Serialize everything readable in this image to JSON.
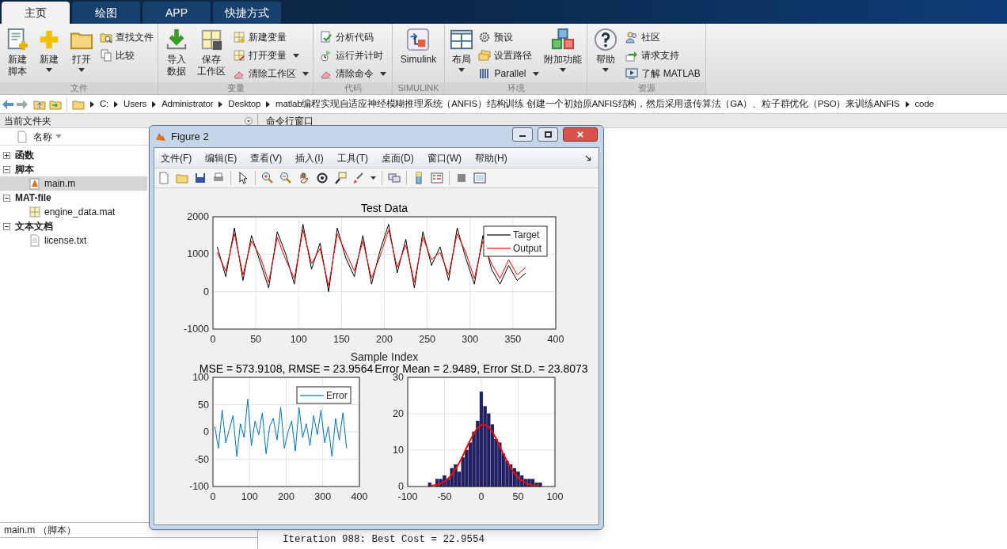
{
  "tabs": [
    {
      "label": "主页",
      "selected": true
    },
    {
      "label": "绘图",
      "selected": false
    },
    {
      "label": "APP",
      "selected": false
    },
    {
      "label": "快捷方式",
      "selected": false
    }
  ],
  "toolstrip": {
    "sections": [
      {
        "label": "文件",
        "groups": [
          {
            "kind": "large",
            "lines": [
              "新建",
              "脚本"
            ],
            "dropdown": false
          },
          {
            "kind": "large",
            "lines": [
              "新建"
            ],
            "dropdown": true
          },
          {
            "kind": "large",
            "lines": [
              "打开"
            ],
            "dropdown": true
          },
          {
            "kind": "column",
            "items": [
              {
                "label": "查找文件",
                "dropdown": false
              },
              {
                "label": "比较",
                "dropdown": false
              }
            ]
          }
        ]
      },
      {
        "label": "变量",
        "groups": [
          {
            "kind": "large",
            "lines": [
              "导入",
              "数据"
            ],
            "dropdown": false
          },
          {
            "kind": "large",
            "lines": [
              "保存",
              "工作区"
            ],
            "dropdown": false
          },
          {
            "kind": "column",
            "items": [
              {
                "label": "新建变量",
                "dropdown": false
              },
              {
                "label": "打开变量",
                "dropdown": true
              },
              {
                "label": "清除工作区",
                "dropdown": true
              }
            ]
          }
        ]
      },
      {
        "label": "代码",
        "groups": [
          {
            "kind": "column",
            "items": [
              {
                "label": "分析代码",
                "dropdown": false
              },
              {
                "label": "运行并计时",
                "dropdown": false
              },
              {
                "label": "清除命令",
                "dropdown": true
              }
            ]
          }
        ]
      },
      {
        "label": "SIMULINK",
        "groups": [
          {
            "kind": "large",
            "lines": [
              "Simulink"
            ],
            "dropdown": false
          }
        ]
      },
      {
        "label": "环境",
        "groups": [
          {
            "kind": "large",
            "lines": [
              "布局"
            ],
            "dropdown": true
          },
          {
            "kind": "column",
            "items": [
              {
                "label": "预设",
                "dropdown": false
              },
              {
                "label": "设置路径",
                "dropdown": false
              },
              {
                "label": "Parallel",
                "dropdown": true
              }
            ]
          },
          {
            "kind": "large",
            "lines": [
              "附加功能"
            ],
            "dropdown": true
          }
        ]
      },
      {
        "label": "资源",
        "groups": [
          {
            "kind": "large",
            "lines": [
              "帮助"
            ],
            "dropdown": true
          },
          {
            "kind": "column",
            "items": [
              {
                "label": "社区",
                "dropdown": false
              },
              {
                "label": "请求支持",
                "dropdown": false
              },
              {
                "label": "了解 MATLAB",
                "dropdown": false
              }
            ]
          }
        ]
      }
    ]
  },
  "address_bar": {
    "path": [
      "C:",
      "Users",
      "Administrator",
      "Desktop",
      "matlab编程实现自适应神经模糊推理系统（ANFIS）结构训练 创建一个初始原ANFIS结构，然后采用遗传算法（GA）、粒子群优化（PSO）来训练ANFIS",
      "code"
    ]
  },
  "current_folder": {
    "title": "当前文件夹",
    "column": "名称",
    "tree": [
      {
        "label": "函数",
        "expanded": false
      },
      {
        "label": "脚本",
        "expanded": true,
        "children": [
          {
            "label": "main.m",
            "kind": "script",
            "selected": true
          }
        ]
      },
      {
        "label": "MAT-file",
        "expanded": true,
        "children": [
          {
            "label": "engine_data.mat",
            "kind": "mat",
            "selected": false
          }
        ]
      },
      {
        "label": "文本文档",
        "expanded": true,
        "children": [
          {
            "label": "license.txt",
            "kind": "text",
            "selected": false
          }
        ]
      }
    ],
    "details": "main.m （脚本）"
  },
  "command_window": {
    "title": "命令行窗口",
    "lines": [
      "Iteration 988: Best Cost = 22.9554"
    ]
  },
  "figure": {
    "title": "Figure 2",
    "menu": [
      "文件(F)",
      "编辑(E)",
      "查看(V)",
      "插入(I)",
      "工具(T)",
      "桌面(D)",
      "窗口(W)",
      "帮助(H)"
    ],
    "charts": [
      {
        "chart_data": {
          "type": "line",
          "title": "Test Data",
          "xlabel": "Sample Index",
          "x": [
            5,
            15,
            25,
            35,
            45,
            55,
            65,
            75,
            85,
            95,
            105,
            115,
            125,
            135,
            145,
            155,
            165,
            175,
            185,
            195,
            205,
            215,
            225,
            235,
            245,
            255,
            265,
            275,
            285,
            295,
            305,
            315,
            325,
            335,
            345,
            355,
            365
          ],
          "xlim": [
            0,
            400
          ],
          "ylim": [
            -1000,
            2000
          ],
          "xticks": [
            0,
            50,
            100,
            150,
            200,
            250,
            300,
            350,
            400
          ],
          "yticks": [
            -1000,
            0,
            1000,
            2000
          ],
          "grid": true,
          "legend": true,
          "series": [
            {
              "name": "Target",
              "color": "#000000",
              "values": [
                1200,
                400,
                1700,
                300,
                1500,
                800,
                100,
                1600,
                1000,
                200,
                1800,
                600,
                1300,
                0,
                1700,
                900,
                400,
                1500,
                200,
                1100,
                1800,
                500,
                1400,
                100,
                1600,
                700,
                1200,
                300,
                1700,
                900,
                200,
                1500,
                600,
                200,
                700,
                300,
                500
              ]
            },
            {
              "name": "Output",
              "color": "#ff0000",
              "values": [
                1050,
                550,
                1550,
                450,
                1350,
                950,
                250,
                1450,
                850,
                350,
                1650,
                750,
                1150,
                150,
                1550,
                1050,
                550,
                1350,
                350,
                950,
                1650,
                650,
                1250,
                250,
                1450,
                850,
                1050,
                450,
                1550,
                1050,
                350,
                1350,
                750,
                350,
                850,
                450,
                650
              ]
            }
          ]
        }
      },
      {
        "chart_data": {
          "type": "line",
          "title": "MSE = 573.9108, RMSE = 23.9564",
          "x": [
            5,
            15,
            25,
            35,
            45,
            55,
            65,
            75,
            85,
            95,
            105,
            115,
            125,
            135,
            145,
            155,
            165,
            175,
            185,
            195,
            205,
            215,
            225,
            235,
            245,
            255,
            265,
            275,
            285,
            295,
            305,
            315,
            325,
            335,
            345,
            355,
            365
          ],
          "xlim": [
            0,
            400
          ],
          "ylim": [
            -100,
            100
          ],
          "xticks": [
            0,
            100,
            200,
            300,
            400
          ],
          "yticks": [
            -100,
            -50,
            0,
            50,
            100
          ],
          "grid": true,
          "legend": true,
          "series": [
            {
              "name": "Error",
              "color": "#0072bd",
              "values": [
                10,
                -30,
                40,
                -20,
                5,
                30,
                -45,
                15,
                -10,
                60,
                -25,
                20,
                -5,
                35,
                -40,
                10,
                25,
                -15,
                45,
                -30,
                0,
                20,
                -35,
                45,
                -10,
                15,
                -25,
                30,
                -5,
                40,
                -20,
                10,
                -45,
                25,
                -15,
                35,
                -30
              ]
            }
          ]
        }
      },
      {
        "chart_data": {
          "type": "bar",
          "title": "Error Mean = 2.9489, Error St.D. = 23.8073",
          "x": [
            -70,
            -65,
            -60,
            -55,
            -50,
            -45,
            -40,
            -35,
            -30,
            -25,
            -20,
            -15,
            -10,
            -5,
            0,
            5,
            10,
            15,
            20,
            25,
            30,
            35,
            40,
            45,
            50,
            55,
            60,
            65,
            70,
            75,
            80
          ],
          "xlim": [
            -100,
            100
          ],
          "ylim": [
            0,
            30
          ],
          "xticks": [
            -100,
            -50,
            0,
            50,
            100
          ],
          "yticks": [
            0,
            10,
            20,
            30
          ],
          "grid": true,
          "series": [
            {
              "type": "bar",
              "color": "#1f1f7a",
              "values": [
                1,
                0,
                2,
                2,
                3,
                2,
                5,
                6,
                4,
                8,
                10,
                12,
                15,
                18,
                26,
                22,
                20,
                17,
                13,
                12,
                9,
                7,
                6,
                5,
                4,
                3,
                2,
                2,
                2,
                1,
                1
              ]
            },
            {
              "type": "line",
              "color": "#ff0000",
              "values": [
                0.2,
                0.3,
                0.5,
                0.9,
                1.4,
                2.2,
                3.3,
                4.8,
                6.5,
                8.5,
                10.7,
                12.8,
                14.6,
                16.1,
                16.9,
                16.9,
                16.3,
                15.0,
                13.2,
                11.1,
                8.9,
                6.9,
                5.1,
                3.6,
                2.4,
                1.6,
                1.0,
                0.6,
                0.3,
                0.2,
                0.1
              ]
            }
          ]
        }
      }
    ]
  }
}
